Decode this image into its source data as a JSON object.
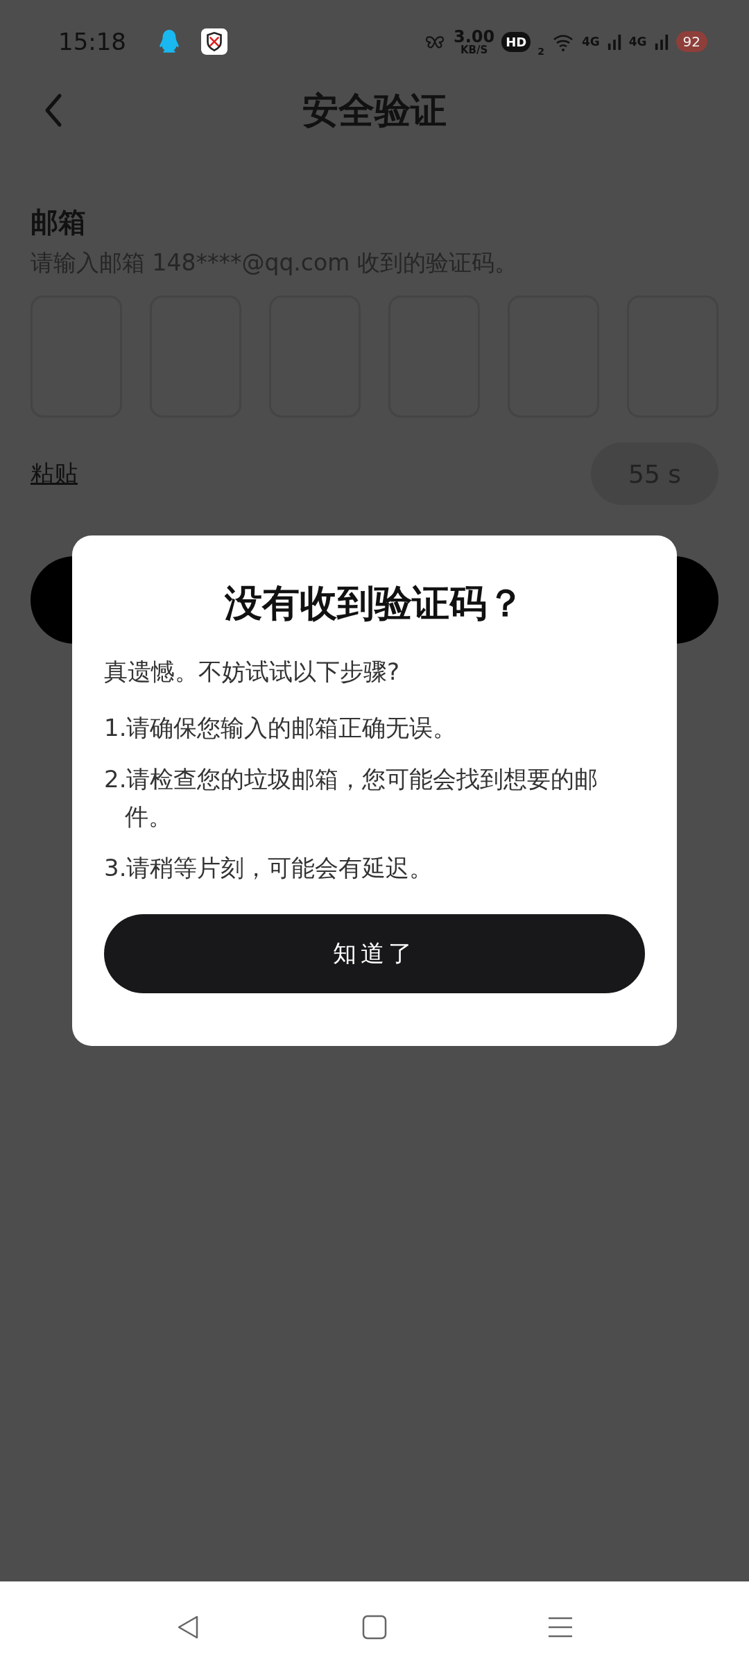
{
  "status_bar": {
    "time": "15:18",
    "speed": "3.00",
    "speed_unit": "KB/S",
    "hd": "HD",
    "hd_sub": "2",
    "network_1": "4G",
    "network_2": "4G",
    "battery": "92"
  },
  "header": {
    "title": "安全验证"
  },
  "form": {
    "label": "邮箱",
    "hint": "请输入邮箱 148****@qq.com 收到的验证码。",
    "code_boxes": [
      {
        "focused": false
      },
      {
        "focused": false
      },
      {
        "focused": false
      },
      {
        "focused": false
      },
      {
        "focused": false
      },
      {
        "focused": false
      }
    ],
    "paste_link": "粘贴",
    "resend": {
      "label": "55 s",
      "disabled": true
    }
  },
  "dialog": {
    "title": "没有收到验证码？",
    "intro": "真遗憾。不妨试试以下步骤?",
    "steps": [
      "1.请确保您输入的邮箱正确无误。",
      "2.请检查您的垃圾邮箱，您可能会找到想要的邮件。",
      "3.请稍等片刻，可能会有延迟。"
    ],
    "button": "知道了"
  }
}
